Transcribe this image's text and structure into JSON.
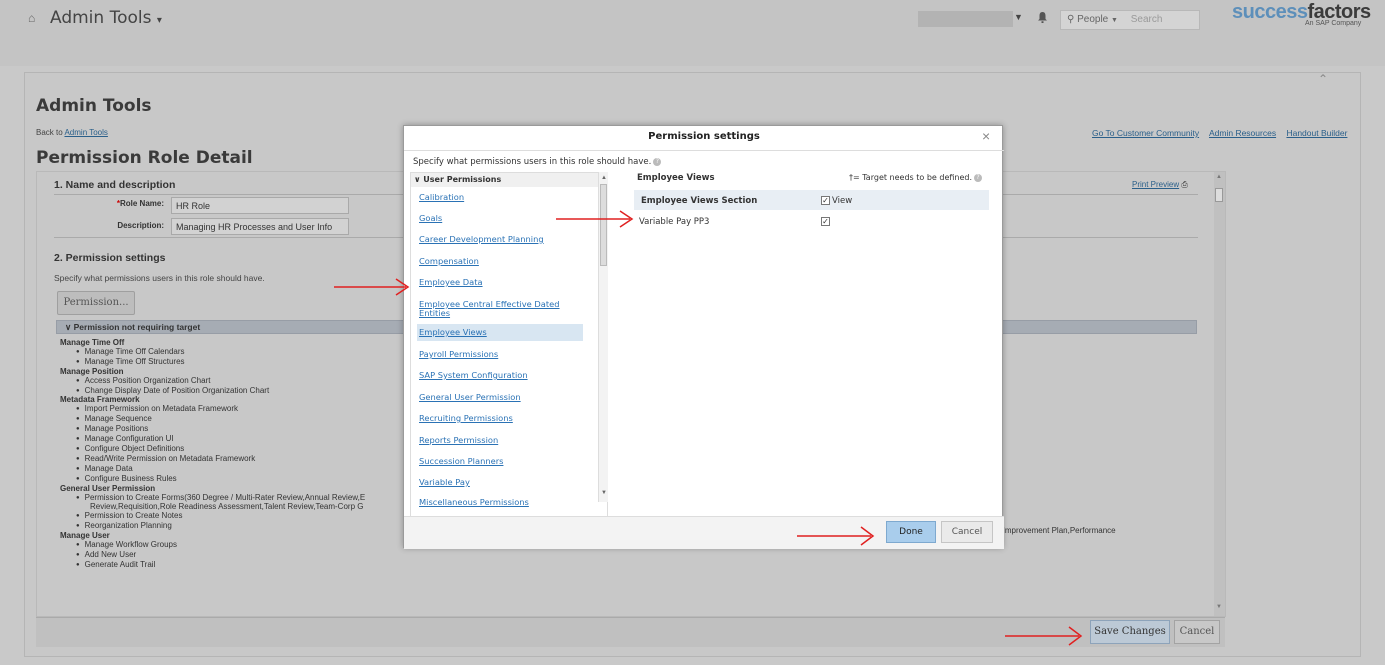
{
  "header": {
    "app_title": "Admin Tools",
    "search_scope": "People",
    "search_placeholder": "Search",
    "logo_part1": "success",
    "logo_part2": "factors",
    "logo_sub": "An SAP Company"
  },
  "page": {
    "heading": "Admin Tools",
    "back_prefix": "Back to",
    "back_link": "Admin Tools",
    "links": [
      "Go To Customer Community",
      "Admin Resources",
      "Handout Builder"
    ],
    "title": "Permission Role Detail",
    "print_preview": "Print Preview"
  },
  "section1": {
    "heading": "1. Name and description",
    "role_name_label": "Role Name:",
    "role_name_value": "HR Role",
    "description_label": "Description:",
    "description_value": "Managing HR Processes and User Info"
  },
  "section2": {
    "heading": "2. Permission settings",
    "desc": "Specify what permissions users in this role should have.",
    "button": "Permission...",
    "bar_label": "Permission not requiring target",
    "list": [
      {
        "type": "grp",
        "text": "Manage Time Off"
      },
      {
        "type": "it",
        "text": "Manage Time Off Calendars"
      },
      {
        "type": "it",
        "text": "Manage Time Off Structures"
      },
      {
        "type": "grp",
        "text": "Manage Position"
      },
      {
        "type": "it",
        "text": "Access Position Organization Chart"
      },
      {
        "type": "it",
        "text": "Change Display Date of Position Organization Chart"
      },
      {
        "type": "grp",
        "text": "Metadata Framework"
      },
      {
        "type": "it",
        "text": "Import Permission on Metadata Framework"
      },
      {
        "type": "it",
        "text": "Manage Sequence"
      },
      {
        "type": "it",
        "text": "Manage Positions"
      },
      {
        "type": "it",
        "text": "Manage Configuration UI"
      },
      {
        "type": "it",
        "text": "Configure Object Definitions"
      },
      {
        "type": "it",
        "text": "Read/Write Permission on Metadata Framework"
      },
      {
        "type": "it",
        "text": "Manage Data"
      },
      {
        "type": "it",
        "text": "Configure Business Rules"
      },
      {
        "type": "grp",
        "text": "General User Permission"
      },
      {
        "type": "it",
        "text": "Permission to Create Forms(360 Degree / Multi-Rater Review,Annual Review,E"
      },
      {
        "type": "wrap",
        "text": "Review,Requisition,Role Readiness Assessment,Talent Review,Team-Corp G"
      },
      {
        "type": "it",
        "text": "Permission to Create Notes"
      },
      {
        "type": "it",
        "text": "Reorganization Planning"
      },
      {
        "type": "grp",
        "text": "Manage User"
      },
      {
        "type": "it",
        "text": "Manage Workflow Groups"
      },
      {
        "type": "it",
        "text": "Add New User"
      },
      {
        "type": "it",
        "text": "Generate Audit Trail"
      }
    ],
    "overflow_text": "e Improvement Plan,Performance"
  },
  "footer": {
    "save": "Save Changes",
    "cancel": "Cancel"
  },
  "modal": {
    "title": "Permission settings",
    "desc": "Specify what permissions users in this role should have.",
    "category_header": "User Permissions",
    "categories": [
      "Calibration",
      "Goals",
      "Career Development Planning",
      "Compensation",
      "Employee Data",
      "Employee Central Effective Dated Entities",
      "Employee Views",
      "Payroll Permissions",
      "SAP System Configuration",
      "General User Permission",
      "Recruiting Permissions",
      "Reports Permission",
      "Succession Planners",
      "Variable Pay",
      "Miscellaneous Permissions"
    ],
    "selected_index": 6,
    "right_header": "Employee Views",
    "target_note": "†= Target needs to be defined.",
    "section_row": "Employee Views Section",
    "view_label": "View",
    "item_row": "Variable Pay PP3",
    "done": "Done",
    "cancel": "Cancel"
  },
  "colors": {
    "arrow": "#e02020",
    "link": "#2a72b5",
    "selected_bg": "#d8e6f2",
    "done_bg": "#a9cdec"
  }
}
